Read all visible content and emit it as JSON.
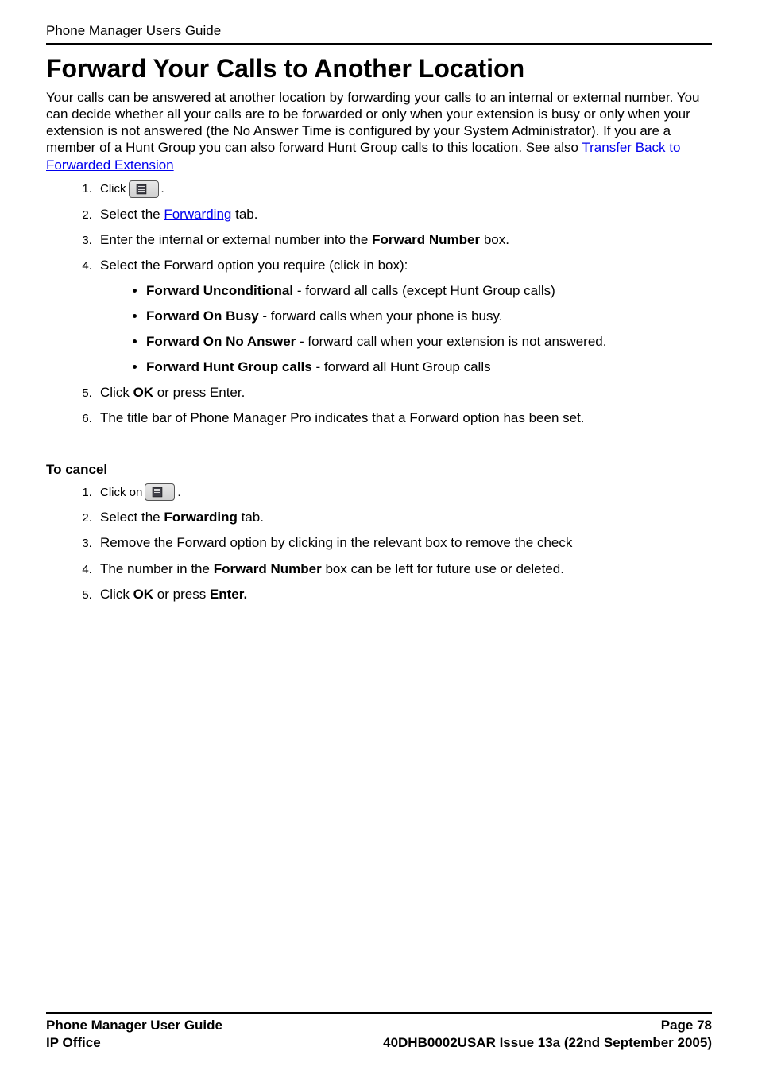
{
  "header": "Phone Manager Users Guide",
  "title": "Forward Your Calls to Another Location",
  "intro": {
    "text": "Your calls can be answered at another location by forwarding your calls to an internal or external number. You can decide whether all your calls are to be forwarded or only when your extension is busy or only when your extension is not answered (the No Answer Time is configured by your System Administrator). If you are a member of a Hunt Group you can also forward Hunt Group calls to this location. See also ",
    "link": "Transfer Back to Forwarded Extension"
  },
  "steps": {
    "s1_prefix": "Click ",
    "s1_suffix": ".",
    "s2_prefix": "Select the ",
    "s2_link": "Forwarding",
    "s2_suffix": " tab.",
    "s3_prefix": "Enter the internal or external number into the ",
    "s3_bold": "Forward Number",
    "s3_suffix": " box.",
    "s4": "Select the Forward option you require (click in box):",
    "b1_bold": "Forward Unconditional",
    "b1_rest": " - forward all calls (except Hunt Group calls)",
    "b2_bold": "Forward On Busy",
    "b2_rest": " - forward calls when your phone is busy.",
    "b3_bold": "Forward On No Answer",
    "b3_rest": " - forward call when your extension is not answered.",
    "b4_bold": "Forward Hunt Group calls",
    "b4_rest": " - forward all Hunt Group calls",
    "s5_prefix": "Click ",
    "s5_bold": "OK",
    "s5_suffix": " or press Enter.",
    "s6": "The title bar of Phone Manager Pro indicates that a Forward option has been set."
  },
  "cancel": {
    "heading": "To cancel",
    "c1_prefix": "Click on ",
    "c1_suffix": ".",
    "c2_prefix": "Select the ",
    "c2_bold": "Forwarding",
    "c2_suffix": " tab.",
    "c3": "Remove the Forward option by clicking in the relevant box to remove the check",
    "c4_prefix": "The number in the ",
    "c4_bold": "Forward Number",
    "c4_suffix": " box can be left for future use or deleted.",
    "c5_prefix": "Click ",
    "c5_bold": "OK",
    "c5_mid": " or press ",
    "c5_bold2": "Enter."
  },
  "footer": {
    "left1": "Phone Manager User Guide",
    "right1": "Page 78",
    "left2": "IP Office",
    "right2": "40DHB0002USAR Issue 13a (22nd September 2005)"
  }
}
